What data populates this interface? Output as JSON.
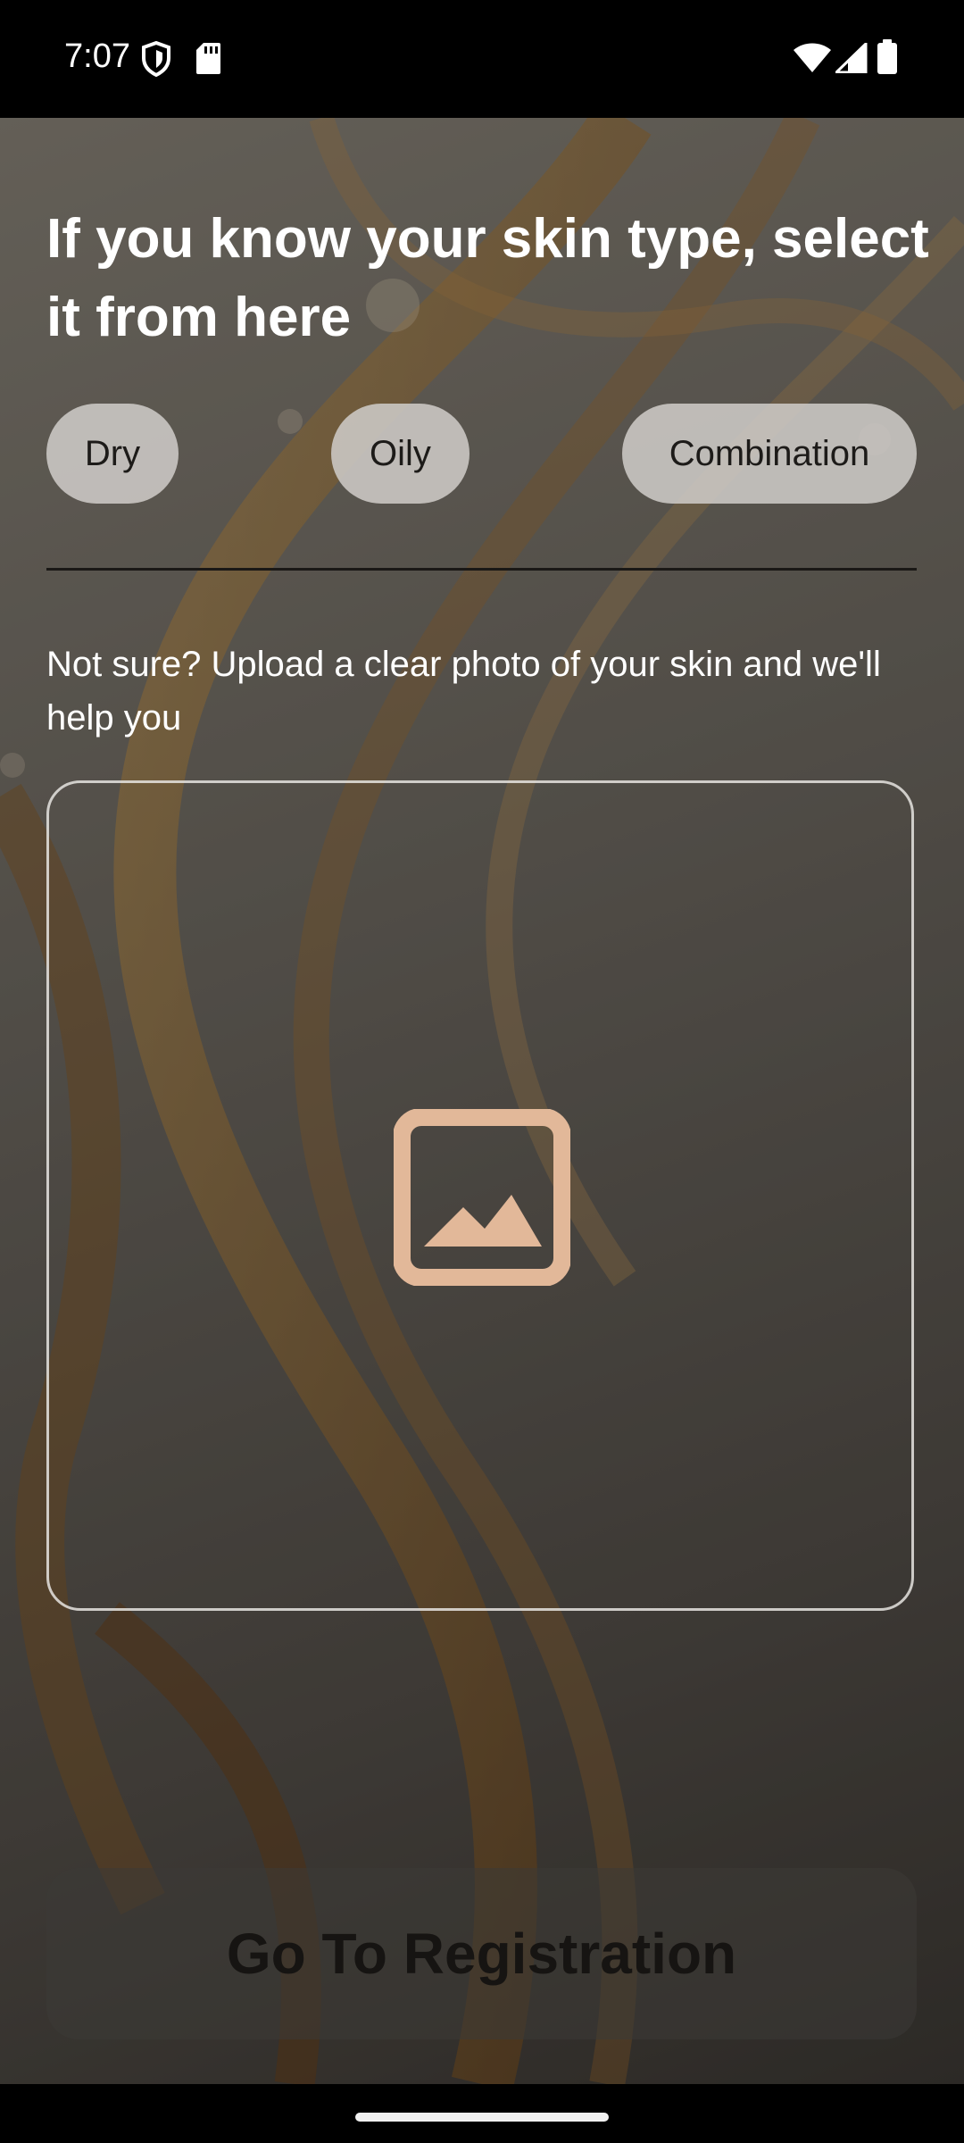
{
  "status_bar": {
    "time": "7:07",
    "left_icons": [
      "shield-icon",
      "sd-card-icon"
    ],
    "right_icons": [
      "wifi-icon",
      "cell-signal-icon",
      "battery-icon"
    ]
  },
  "heading": "If you know your skin type, select it from here",
  "skin_types": [
    {
      "label": "Dry"
    },
    {
      "label": "Oily"
    },
    {
      "label": "Combination"
    }
  ],
  "upload": {
    "helper_text": "Not sure? Upload a clear photo of your skin and we'll help you",
    "icon": "image-icon",
    "icon_color": "#e2b899"
  },
  "cta": {
    "label": "Go To Registration"
  },
  "navigation": {
    "home_indicator": "home-indicator"
  }
}
